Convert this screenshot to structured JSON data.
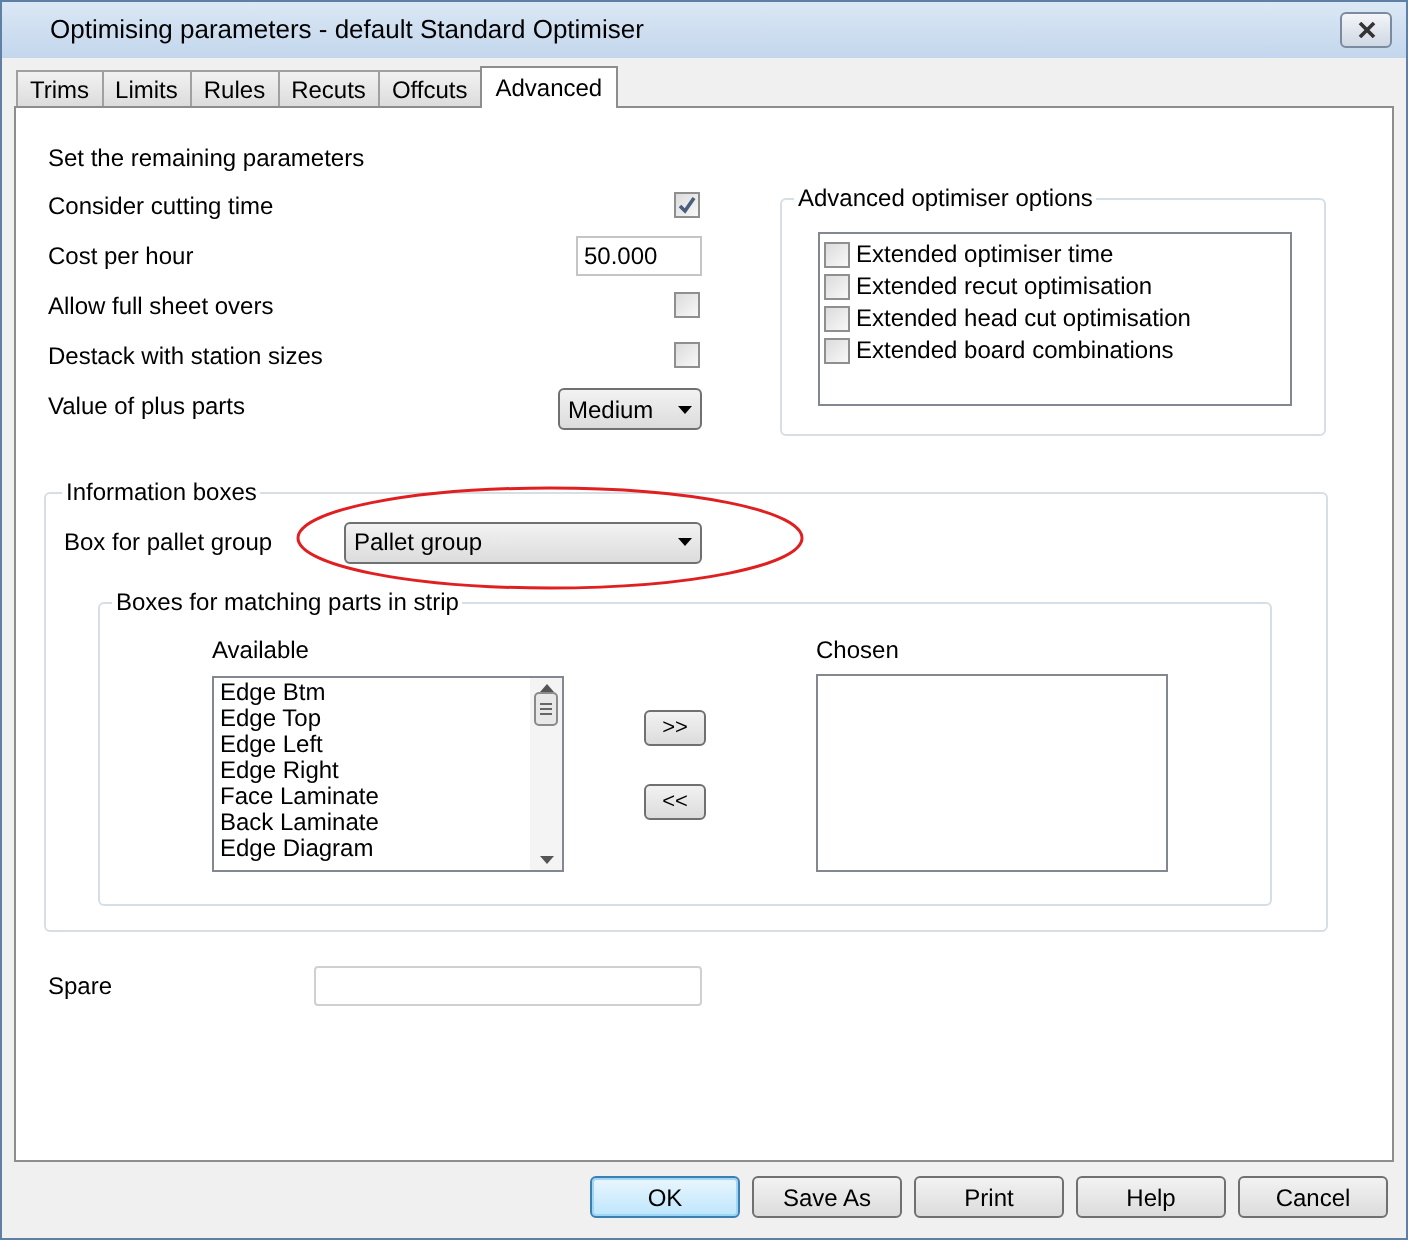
{
  "window": {
    "title": "Optimising parameters - default Standard Optimiser"
  },
  "tabs": [
    {
      "label": "Trims",
      "selected": false
    },
    {
      "label": "Limits",
      "selected": false
    },
    {
      "label": "Rules",
      "selected": false
    },
    {
      "label": "Recuts",
      "selected": false
    },
    {
      "label": "Offcuts",
      "selected": false
    },
    {
      "label": "Advanced",
      "selected": true
    }
  ],
  "parameters": {
    "heading": "Set the remaining parameters",
    "rows": [
      {
        "kind": "checkbox",
        "label": "Consider cutting time",
        "checked": true
      },
      {
        "kind": "input",
        "label": "Cost per hour",
        "value": "50.000"
      },
      {
        "kind": "checkbox",
        "label": "Allow full sheet overs",
        "checked": false
      },
      {
        "kind": "checkbox",
        "label": "Destack with station sizes",
        "checked": false
      },
      {
        "kind": "dropdown",
        "label": "Value of plus parts",
        "value": "Medium"
      }
    ]
  },
  "optimiser_options": {
    "title": "Advanced optimiser options",
    "items": [
      {
        "label": "Extended optimiser time",
        "checked": false
      },
      {
        "label": "Extended recut optimisation",
        "checked": false
      },
      {
        "label": "Extended head cut optimisation",
        "checked": false
      },
      {
        "label": "Extended board combinations",
        "checked": false
      }
    ]
  },
  "information_boxes": {
    "title": "Information boxes",
    "pallet_label": "Box for pallet group",
    "pallet_value": "Pallet group",
    "highlighted": true,
    "matching": {
      "title": "Boxes for matching parts in strip",
      "available_label": "Available",
      "available": [
        "Edge Btm",
        "Edge Top",
        "Edge Left",
        "Edge Right",
        "Face Laminate",
        "Back Laminate",
        "Edge Diagram"
      ],
      "chosen_label": "Chosen",
      "add_button": ">>",
      "remove_button": "<<"
    }
  },
  "spare": {
    "label": "Spare"
  },
  "buttons": [
    {
      "label": "OK",
      "default": true
    },
    {
      "label": "Save As",
      "default": false
    },
    {
      "label": "Print",
      "default": false
    },
    {
      "label": "Help",
      "default": false
    },
    {
      "label": "Cancel",
      "default": false
    }
  ]
}
